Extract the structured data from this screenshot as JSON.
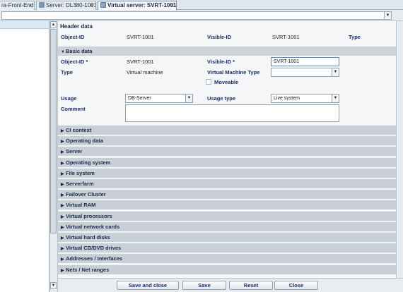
{
  "tabs": [
    {
      "label": "ra-Front-End",
      "icon": "none",
      "active": false
    },
    {
      "label": "Server: DL380-1001",
      "icon": "server-icon",
      "active": false
    },
    {
      "label": "Virtual server: SVRT-1001",
      "icon": "virtual-server-icon",
      "active": true
    }
  ],
  "tab_close_glyph": "×",
  "header": {
    "title": "Header data",
    "object_id_label": "Object-ID",
    "object_id_value": "SVRT-1001",
    "visible_id_label": "Visible-ID",
    "visible_id_value": "SVRT-1001",
    "type_label": "Type"
  },
  "basic": {
    "title": "Basic data",
    "object_id_label": "Object-ID *",
    "object_id_value": "SVRT-1001",
    "visible_id_label": "Visible-ID *",
    "visible_id_value": "SVRT-1001",
    "type_label": "Type",
    "type_value": "Virtual machine",
    "vm_type_label": "Virtual Machine Type",
    "vm_type_value": "",
    "moveable_label": "Moveable",
    "moveable_checked": false,
    "usage_label": "Usage",
    "usage_value": "DB-Server",
    "usage_type_label": "Usage type",
    "usage_type_value": "Live system",
    "comment_label": "Comment",
    "comment_value": ""
  },
  "sections": [
    "CI context",
    "Operating data",
    "Server",
    "Operating system",
    "File system",
    "Serverfarm",
    "Failover Cluster",
    "Virtual RAM",
    "Virtual processors",
    "Virtual network cards",
    "Virtual hard disks",
    "Virtual CD/DVD drives",
    "Addresses / Interfaces",
    "Nets / Net ranges"
  ],
  "buttons": {
    "save_close": "Save and close",
    "save": "Save",
    "reset": "Reset",
    "close": "Close"
  },
  "colors": {
    "label": "#1a2e6b",
    "section_bg": "#c9cfd6",
    "active_tab_border": "#6e8fb0"
  }
}
